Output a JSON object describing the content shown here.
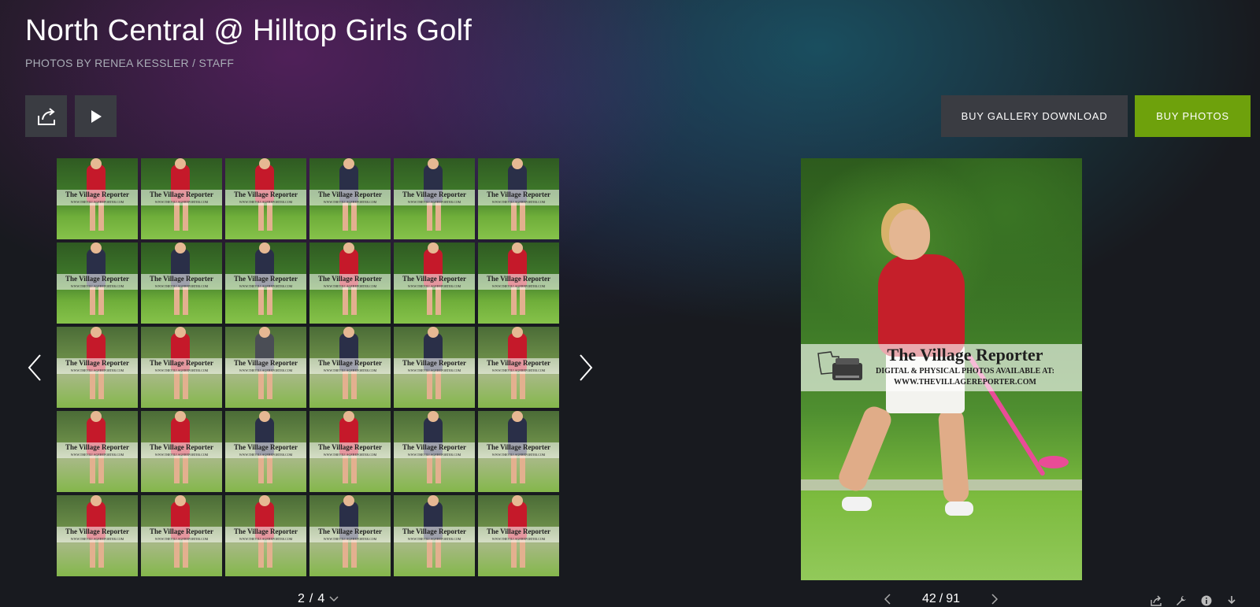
{
  "header": {
    "title": "North Central @ Hilltop Girls Golf",
    "subtitle": "PHOTOS BY RENEA KESSLER / STAFF"
  },
  "toolbar": {
    "share_icon": "share-icon",
    "play_icon": "play-icon",
    "buy_gallery_label": "BUY GALLERY DOWNLOAD",
    "buy_photos_label": "BUY PHOTOS"
  },
  "colors": {
    "buy_photos_bg": "#6ea10c",
    "button_dark_bg": "#3a3c42",
    "page_bg": "#181a1f"
  },
  "watermark": {
    "title": "The Village Reporter",
    "line1": "DIGITAL & PHYSICAL PHOTOS AVAILABLE AT:",
    "line2": "WWW.THEVILLAGEREPORTER.COM"
  },
  "grid": {
    "pager": {
      "current": "2",
      "separator": "/",
      "total": "4"
    },
    "thumbnails": [
      {
        "tone": "red"
      },
      {
        "tone": "red"
      },
      {
        "tone": "red"
      },
      {
        "tone": "navy"
      },
      {
        "tone": "navy"
      },
      {
        "tone": "navy"
      },
      {
        "tone": "navy"
      },
      {
        "tone": "navy"
      },
      {
        "tone": "navy"
      },
      {
        "tone": "red"
      },
      {
        "tone": "red"
      },
      {
        "tone": "red"
      },
      {
        "tone": "red"
      },
      {
        "tone": "red"
      },
      {
        "tone": "gray"
      },
      {
        "tone": "navy"
      },
      {
        "tone": "navy"
      },
      {
        "tone": "red"
      },
      {
        "tone": "red"
      },
      {
        "tone": "red"
      },
      {
        "tone": "navy"
      },
      {
        "tone": "red"
      },
      {
        "tone": "navy"
      },
      {
        "tone": "navy"
      },
      {
        "tone": "red"
      },
      {
        "tone": "red"
      },
      {
        "tone": "red"
      },
      {
        "tone": "navy"
      },
      {
        "tone": "navy"
      },
      {
        "tone": "red"
      }
    ]
  },
  "viewer": {
    "pager": {
      "current": "42",
      "separator": "/",
      "total": "91"
    }
  },
  "tools": {
    "icons": [
      "share-icon",
      "wrench-icon",
      "info-icon",
      "download-icon"
    ]
  }
}
